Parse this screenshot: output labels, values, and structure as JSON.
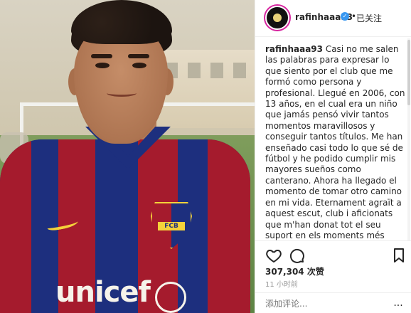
{
  "post": {
    "username": "rafinhaaa93",
    "follow_state": "已关注",
    "caption_user": "rafinhaaa93",
    "caption_text": "Casi no me salen las palabras para expresar lo que siento por el club que me formó como persona y profesional. Llegué en 2006, con 13 años, en el cual era un niño que jamás pensó vivir tantos momentos maravillosos y conseguir tantos títulos. Me han enseñado casi todo lo que sé de fútbol y he podido cumplir mis mayores sueños como canterano. Ahora ha llegado el momento de tomar otro camino en mi vida. Eternament agraït a aquest escut, club i aficionats que m'han donat tot el seu suport en els moments més durs. Sou increïbles. A mis compañeros, que he podido crecer aprendiendo de ellos: Gracias de todo corazón. Os desearé siempre lo mejor. A todos los trabajadores, del primero al último, que me han",
    "likes": "307,304 次赞",
    "time": "11 小时前",
    "comment_placeholder": "添加评论...",
    "more": "..."
  },
  "photo": {
    "sponsor_text": "unicef",
    "crest_text": "FCB"
  },
  "icons": {
    "avatar": "avatar",
    "verified": "verified-icon",
    "heart": "heart-icon",
    "comment": "comment-icon",
    "bookmark": "bookmark-icon"
  },
  "colors": {
    "verified": "#3897f0",
    "barca_red": "#a51b2d",
    "barca_blue": "#1d2f7e",
    "barca_yellow": "#f4d23a"
  }
}
